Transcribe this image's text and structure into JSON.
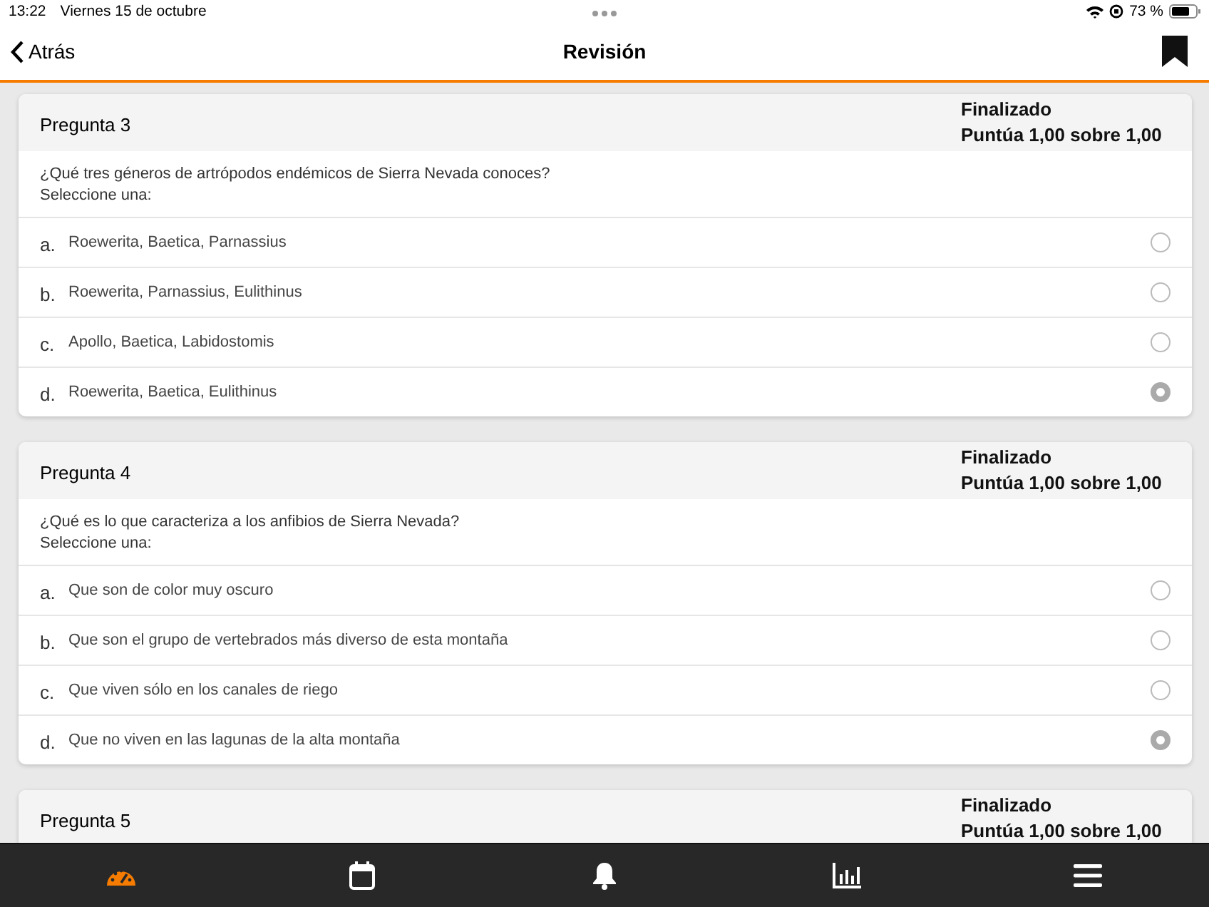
{
  "status_bar": {
    "time": "13:22",
    "date": "Viernes 15 de octubre",
    "battery": "73 %"
  },
  "nav": {
    "back": "Atrás",
    "title": "Revisión"
  },
  "questions": [
    {
      "title": "Pregunta 3",
      "state": "Finalizado",
      "grade": "Puntúa 1,00 sobre 1,00",
      "text": "¿Qué tres géneros de artrópodos endémicos de Sierra Nevada conoces?",
      "instruction": "Seleccione una:",
      "options": [
        {
          "letter": "a.",
          "text": "Roewerita, Baetica, Parnassius",
          "selected": false
        },
        {
          "letter": "b.",
          "text": "Roewerita, Parnassius, Eulithinus",
          "selected": false
        },
        {
          "letter": "c.",
          "text": "Apollo, Baetica, Labidostomis",
          "selected": false
        },
        {
          "letter": "d.",
          "text": "Roewerita, Baetica, Eulithinus",
          "selected": true
        }
      ]
    },
    {
      "title": "Pregunta 4",
      "state": "Finalizado",
      "grade": "Puntúa 1,00 sobre 1,00",
      "text": "¿Qué es lo que caracteriza a los anfibios de Sierra Nevada?",
      "instruction": "Seleccione una:",
      "options": [
        {
          "letter": "a.",
          "text": "Que son de color muy oscuro",
          "selected": false
        },
        {
          "letter": "b.",
          "text": "Que son el grupo de vertebrados más diverso de esta montaña",
          "selected": false
        },
        {
          "letter": "c.",
          "text": "Que viven sólo en los canales de riego",
          "selected": false
        },
        {
          "letter": "d.",
          "text": "Que no viven en las lagunas de la alta montaña",
          "selected": true
        }
      ]
    },
    {
      "title": "Pregunta 5",
      "state": "Finalizado",
      "grade": "Puntúa 1,00 sobre 1,00"
    }
  ],
  "tabs": [
    {
      "kind": "dashboard",
      "selected": true
    },
    {
      "kind": "calendar",
      "selected": false
    },
    {
      "kind": "notifications",
      "selected": false
    },
    {
      "kind": "grades",
      "selected": false
    },
    {
      "kind": "menu",
      "selected": false
    }
  ]
}
